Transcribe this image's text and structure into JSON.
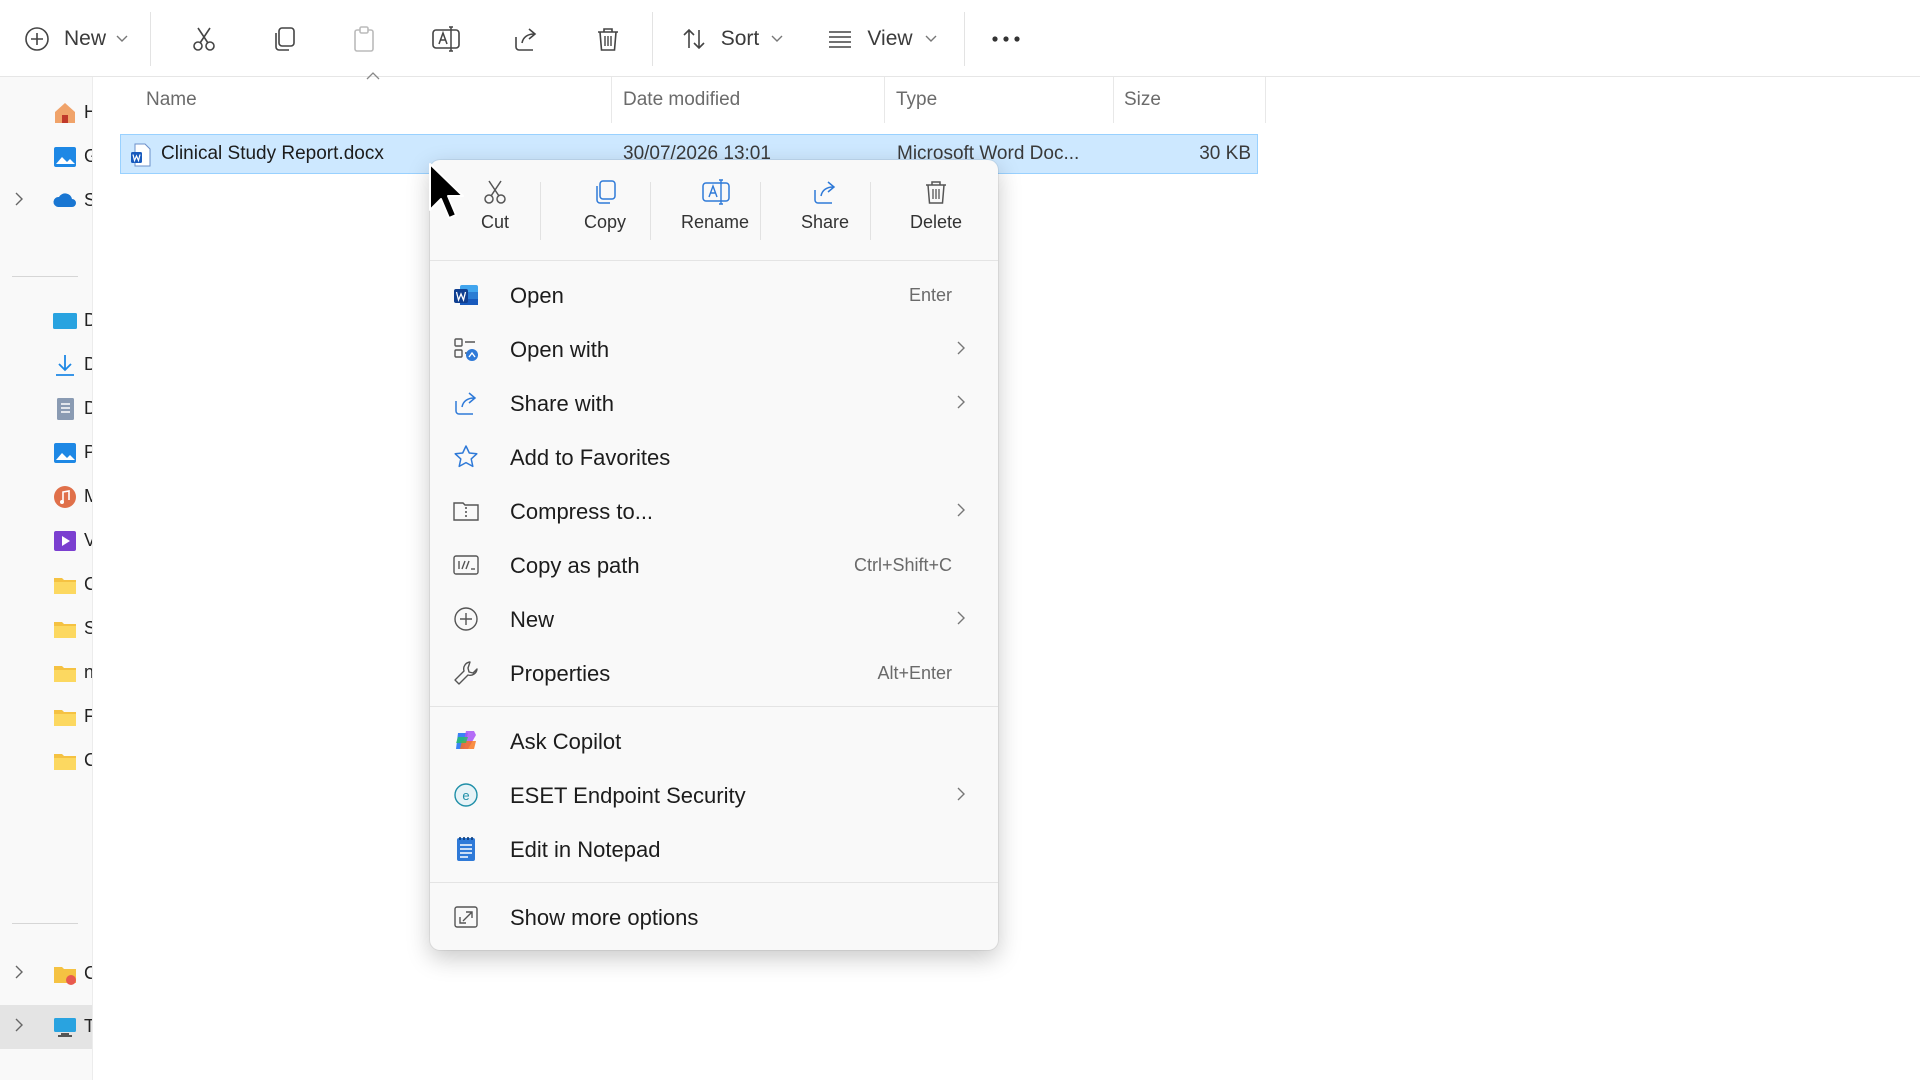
{
  "toolbar": {
    "new_label": "New",
    "sort_label": "Sort",
    "view_label": "View",
    "icons": [
      "cut-icon",
      "copy-icon",
      "paste-icon",
      "rename-icon",
      "share-icon",
      "delete-icon",
      "sort-icon",
      "view-icon",
      "more-icon"
    ]
  },
  "columns": {
    "name": "Name",
    "date_modified": "Date modified",
    "type": "Type",
    "size": "Size"
  },
  "file": {
    "name": "Clinical Study Report.docx",
    "date_modified": "30/07/2026 13:01",
    "type": "Microsoft Word Doc...",
    "size": "30 KB"
  },
  "sidebar": {
    "items": [
      {
        "text": "H",
        "icon": "home-icon"
      },
      {
        "text": "G",
        "icon": "gallery-icon"
      },
      {
        "text": "S",
        "icon": "onedrive-icon"
      },
      {
        "text": "D",
        "icon": "desktop-icon"
      },
      {
        "text": "D",
        "icon": "downloads-icon"
      },
      {
        "text": "D",
        "icon": "documents-icon"
      },
      {
        "text": "P",
        "icon": "pictures-icon"
      },
      {
        "text": "M",
        "icon": "music-icon"
      },
      {
        "text": "V",
        "icon": "videos-icon"
      },
      {
        "text": "C",
        "icon": "folder-icon"
      },
      {
        "text": "S",
        "icon": "folder-icon"
      },
      {
        "text": "n",
        "icon": "folder-icon"
      },
      {
        "text": "F",
        "icon": "folder-icon"
      },
      {
        "text": "C",
        "icon": "folder-icon"
      },
      {
        "text": "C",
        "icon": "network-drive-icon"
      },
      {
        "text": "T",
        "icon": "this-pc-icon"
      }
    ]
  },
  "context_menu": {
    "quick_actions": [
      {
        "label": "Cut",
        "icon": "cut-icon"
      },
      {
        "label": "Copy",
        "icon": "copy-icon"
      },
      {
        "label": "Rename",
        "icon": "rename-icon"
      },
      {
        "label": "Share",
        "icon": "share-icon"
      },
      {
        "label": "Delete",
        "icon": "delete-icon"
      }
    ],
    "items": [
      {
        "label": "Open",
        "shortcut": "Enter",
        "icon": "word-icon"
      },
      {
        "label": "Open with",
        "shortcut": "",
        "icon": "open-with-icon",
        "submenu": true
      },
      {
        "label": "Share with",
        "shortcut": "",
        "icon": "share-icon",
        "submenu": true
      },
      {
        "label": "Add to Favorites",
        "shortcut": "",
        "icon": "star-icon"
      },
      {
        "label": "Compress to...",
        "shortcut": "",
        "icon": "zip-icon",
        "submenu": true
      },
      {
        "label": "Copy as path",
        "shortcut": "Ctrl+Shift+C",
        "icon": "path-icon"
      },
      {
        "label": "New",
        "shortcut": "",
        "icon": "plus-circle-icon",
        "submenu": true
      },
      {
        "label": "Properties",
        "shortcut": "Alt+Enter",
        "icon": "wrench-icon"
      },
      {
        "label": "Ask Copilot",
        "shortcut": "",
        "icon": "copilot-icon"
      },
      {
        "label": "ESET Endpoint Security",
        "shortcut": "",
        "icon": "eset-icon",
        "submenu": true
      },
      {
        "label": "Edit in Notepad",
        "shortcut": "",
        "icon": "notepad-icon"
      },
      {
        "label": "Show more options",
        "shortcut": "",
        "icon": "more-options-icon"
      }
    ]
  },
  "colors": {
    "selection_fill": "#cde8ff",
    "selection_border": "#99d1ff",
    "menu_bg": "#f9f9f9",
    "accent": "#0067c0"
  }
}
